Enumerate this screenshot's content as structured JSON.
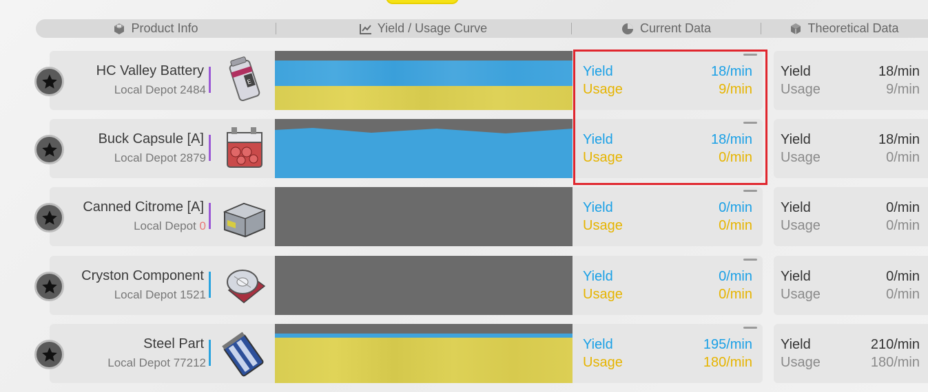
{
  "header": {
    "product_info": "Product Info",
    "curve": "Yield / Usage Curve",
    "current": "Current Data",
    "theoretical": "Theoretical Data"
  },
  "rows": [
    {
      "name": "HC Valley Battery",
      "depot_label": "Local Depot",
      "depot_value": "2484",
      "current": {
        "yield_label": "Yield",
        "yield": "18/min",
        "usage_label": "Usage",
        "usage": "9/min"
      },
      "theoretical": {
        "yield_label": "Yield",
        "yield": "18/min",
        "usage_label": "Usage",
        "usage": "9/min"
      }
    },
    {
      "name": "Buck Capsule [A]",
      "depot_label": "Local Depot",
      "depot_value": "2879",
      "current": {
        "yield_label": "Yield",
        "yield": "18/min",
        "usage_label": "Usage",
        "usage": "0/min"
      },
      "theoretical": {
        "yield_label": "Yield",
        "yield": "18/min",
        "usage_label": "Usage",
        "usage": "0/min"
      }
    },
    {
      "name": "Canned Citrome [A]",
      "depot_label": "Local Depot",
      "depot_value": "0",
      "current": {
        "yield_label": "Yield",
        "yield": "0/min",
        "usage_label": "Usage",
        "usage": "0/min"
      },
      "theoretical": {
        "yield_label": "Yield",
        "yield": "0/min",
        "usage_label": "Usage",
        "usage": "0/min"
      }
    },
    {
      "name": "Cryston Component",
      "depot_label": "Local Depot",
      "depot_value": "1521",
      "current": {
        "yield_label": "Yield",
        "yield": "0/min",
        "usage_label": "Usage",
        "usage": "0/min"
      },
      "theoretical": {
        "yield_label": "Yield",
        "yield": "0/min",
        "usage_label": "Usage",
        "usage": "0/min"
      }
    },
    {
      "name": "Steel Part",
      "depot_label": "Local Depot",
      "depot_value": "77212",
      "current": {
        "yield_label": "Yield",
        "yield": "195/min",
        "usage_label": "Usage",
        "usage": "180/min"
      },
      "theoretical": {
        "yield_label": "Yield",
        "yield": "210/min",
        "usage_label": "Usage",
        "usage": "180/min"
      }
    }
  ],
  "colors": {
    "yield": "#1aa0e6",
    "usage": "#e6b400",
    "highlight": "#e0262e",
    "curve_bg": "#6b6b6b"
  }
}
